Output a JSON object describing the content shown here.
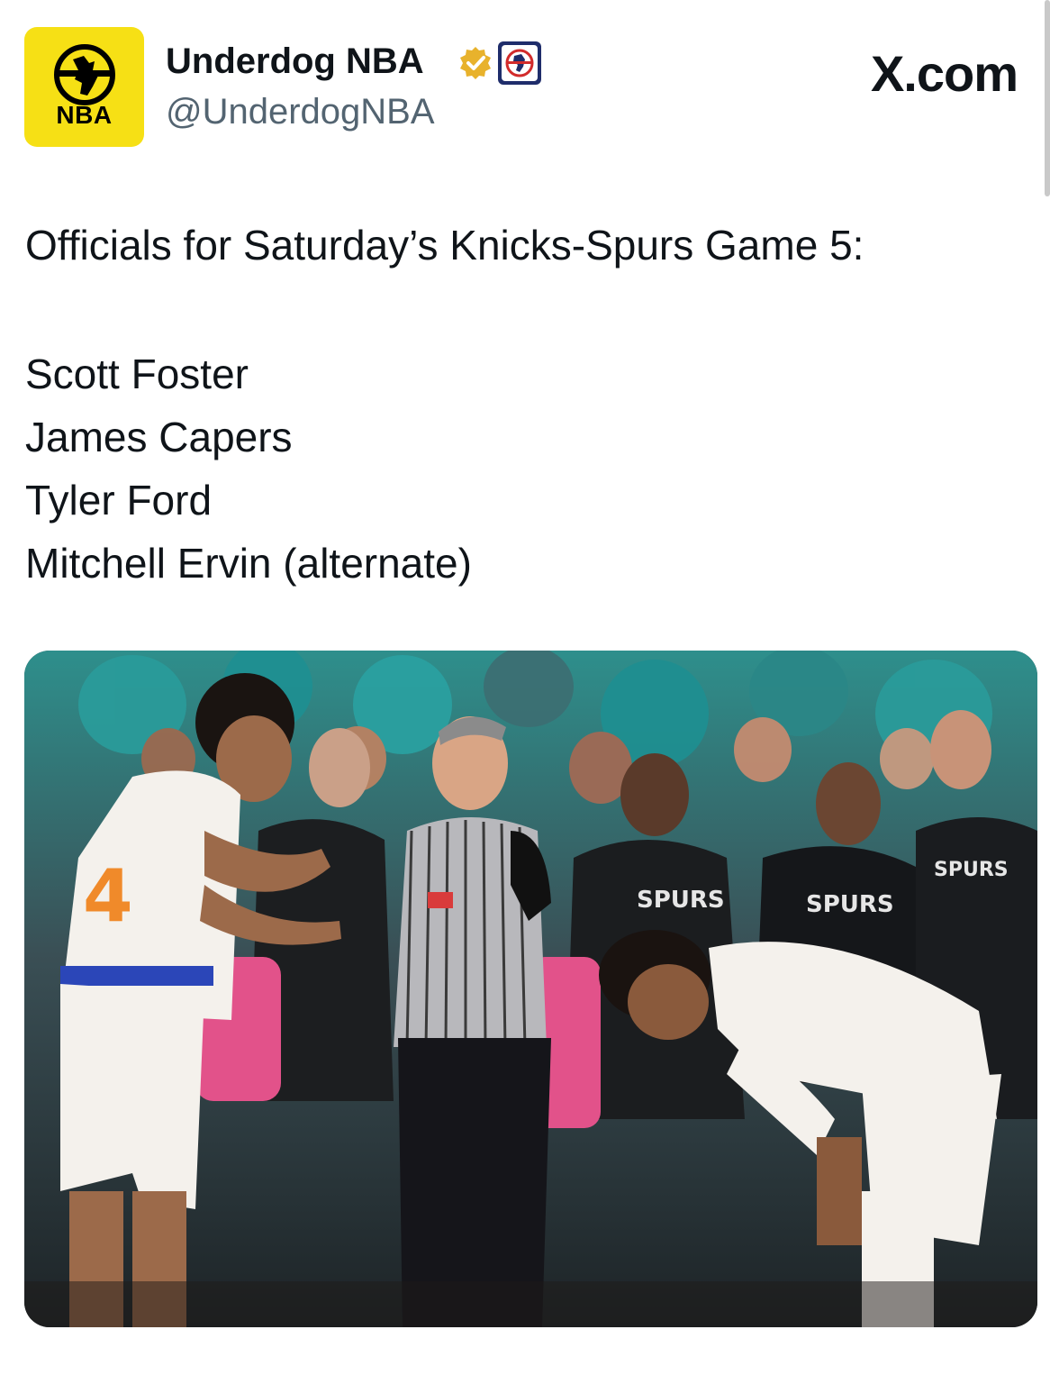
{
  "header": {
    "avatar_label": "NBA",
    "display_name": "Underdog NBA",
    "handle": "@UnderdogNBA",
    "site_logo": "X.com",
    "verified_icon": "verified-badge-icon",
    "affiliate_icon": "underdog-affiliate-icon"
  },
  "tweet": {
    "text": "Officials for Saturday’s Knicks-Spurs Game 5:",
    "officials": [
      "Scott Foster",
      "James Capers",
      "Tyler Ford",
      "Mitchell Ervin (alternate)"
    ]
  },
  "media": {
    "type": "photo",
    "jersey_text": "SPURS"
  },
  "colors": {
    "brand_yellow": "#f6e015",
    "verified_gold": "#e8b22c",
    "text": "#0f1419",
    "secondary_text": "#536471",
    "crowd_teal": "#1f8f91",
    "crowd_pink": "#e2528a"
  }
}
